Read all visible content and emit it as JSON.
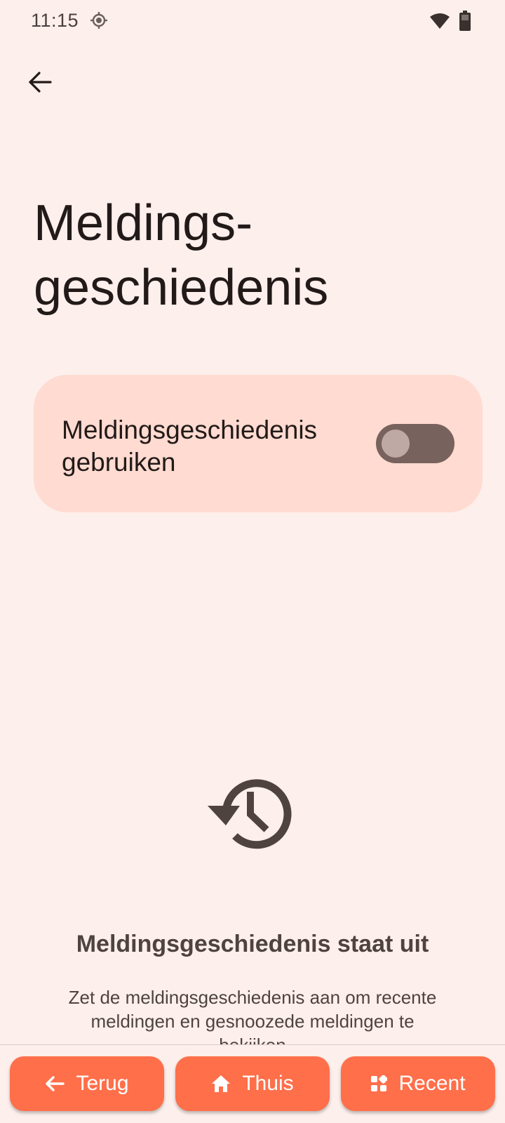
{
  "status_bar": {
    "time": "11:15",
    "icons": [
      "location-icon",
      "wifi-icon",
      "battery-icon"
    ]
  },
  "header": {
    "back_icon": "arrow-left-icon",
    "title_line1": "Meldings-",
    "title_line2": "geschiedenis"
  },
  "toggle": {
    "label_line1": "Meldingsgeschiedenis",
    "label_line2": "gebruiken",
    "state": "off"
  },
  "empty_state": {
    "icon": "history-icon",
    "title": "Meldingsgeschiedenis staat uit",
    "description": "Zet de meldingsgeschiedenis aan om recente meldingen en gesnoozede meldingen te bekijken"
  },
  "bottom_nav": {
    "back_label": "Terug",
    "home_label": "Thuis",
    "recent_label": "Recent"
  },
  "colors": {
    "background": "#fcefec",
    "card": "#ffdbd1",
    "switch_track": "#78625d",
    "nav_button": "#ff6f4a"
  }
}
